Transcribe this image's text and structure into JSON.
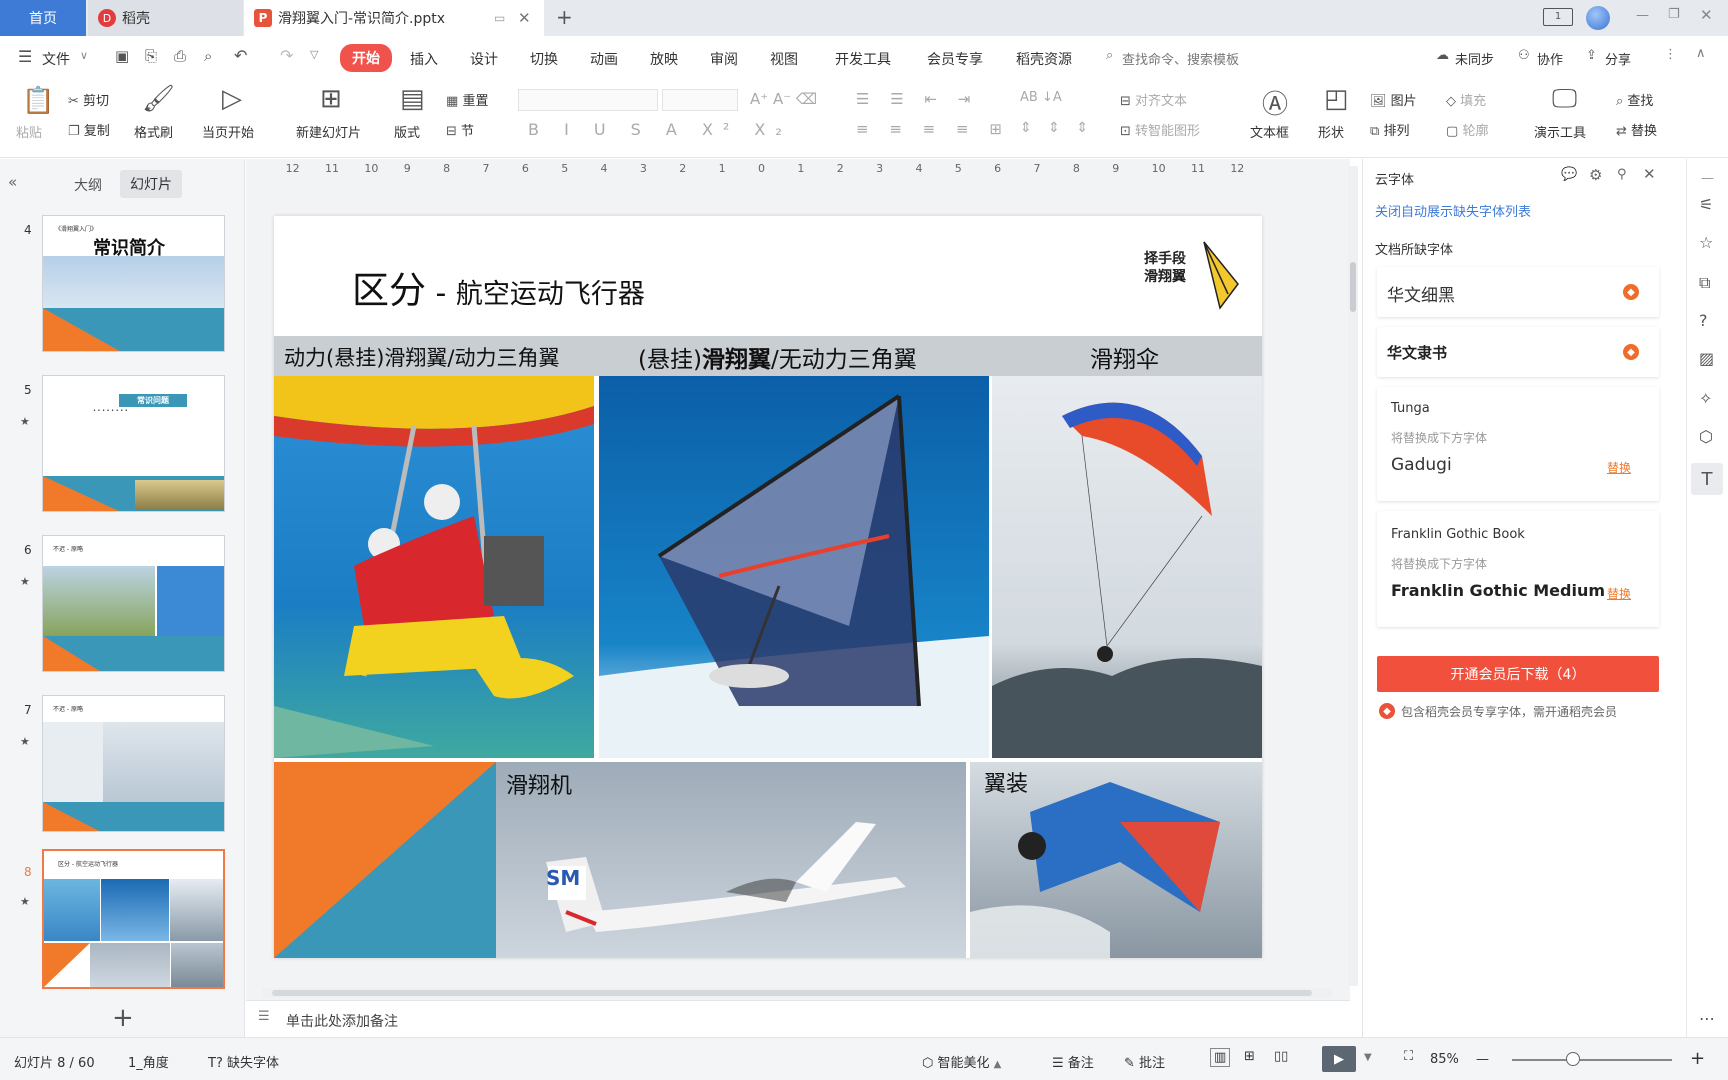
{
  "tabs": {
    "home": "首页",
    "daoke": "稻壳",
    "doc": "滑翔翼入门-常识简介.pptx"
  },
  "menu": {
    "file": "文件",
    "items": [
      "开始",
      "插入",
      "设计",
      "切换",
      "动画",
      "放映",
      "审阅",
      "视图",
      "开发工具",
      "会员专享",
      "稻壳资源"
    ],
    "search": "查找命令、搜索模板",
    "sync": "未同步",
    "collab": "协作",
    "share": "分享"
  },
  "ribbon": {
    "paste": "粘贴",
    "cut": "剪切",
    "copy": "复制",
    "format_painter": "格式刷",
    "play_from": "当页开始",
    "new_slide": "新建幻灯片",
    "layout": "版式",
    "reset": "重置",
    "section": "节",
    "align_text": "对齐文本",
    "smart_art": "转智能图形",
    "textbox": "文本框",
    "shape": "形状",
    "picture": "图片",
    "arrange": "排列",
    "fill": "填充",
    "outline": "轮廓",
    "demo_tools": "演示工具",
    "find": "查找",
    "replace": "替换"
  },
  "left": {
    "outline": "大纲",
    "slides": "幻灯片",
    "thumbs": [
      {
        "num": "4",
        "title": "常识简介",
        "sub": "《滑翔翼入门》"
      },
      {
        "num": "5",
        "title": "常识问题",
        "sub": "常识问题"
      },
      {
        "num": "6",
        "title": "不迟 - 原略",
        "sub": ""
      },
      {
        "num": "7",
        "title": "不迟 - 原略",
        "sub": ""
      },
      {
        "num": "8",
        "title": "区分 - 航空运动飞行器",
        "sub": ""
      }
    ]
  },
  "slide": {
    "title_main": "区分",
    "title_dash": " - ",
    "title_sub": "航空运动飞行器",
    "logo_l1": "择手段",
    "logo_l2": "滑翔翼",
    "col1": "动力(悬挂)滑翔翼/动力三角翼",
    "col2_a": "(悬挂)",
    "col2_b": "滑翔翼",
    "col2_c": "/无动力三角翼",
    "col3": "滑翔伞",
    "glider": "滑翔机",
    "wingsuit": "翼装",
    "glider_tail": "SM"
  },
  "notes": "单击此处添加备注",
  "ruler": [
    "12",
    "11",
    "10",
    "9",
    "8",
    "7",
    "6",
    "5",
    "4",
    "3",
    "2",
    "1",
    "0",
    "1",
    "2",
    "3",
    "4",
    "5",
    "6",
    "7",
    "8",
    "9",
    "10",
    "11",
    "12"
  ],
  "right": {
    "header": "云字体",
    "close_auto": "关闭自动展示缺失字体列表",
    "missing": "文档所缺字体",
    "f1": "华文细黑",
    "f2": "华文隶书",
    "f3": "Tunga",
    "f3_hint": "将替换成下方字体",
    "f3_rep": "Gadugi",
    "f4": "Franklin Gothic Book",
    "f4_hint": "将替换成下方字体",
    "f4_rep": "Franklin Gothic Medium",
    "replace": "替换",
    "download": "开通会员后下载（4）",
    "note": "包含稻壳会员专享字体，需开通稻壳会员"
  },
  "status": {
    "slide_pos": "幻灯片 8 / 60",
    "theme": "1_角度",
    "missing_font": "缺失字体",
    "beautify": "智能美化",
    "notes": "备注",
    "comment": "批注",
    "zoom": "85%",
    "zoom_level": 0.85
  },
  "colors": {
    "accent": "#f0534c",
    "orange": "#f07a2a",
    "teal": "#3a97b8",
    "link": "#3e7bd6"
  }
}
